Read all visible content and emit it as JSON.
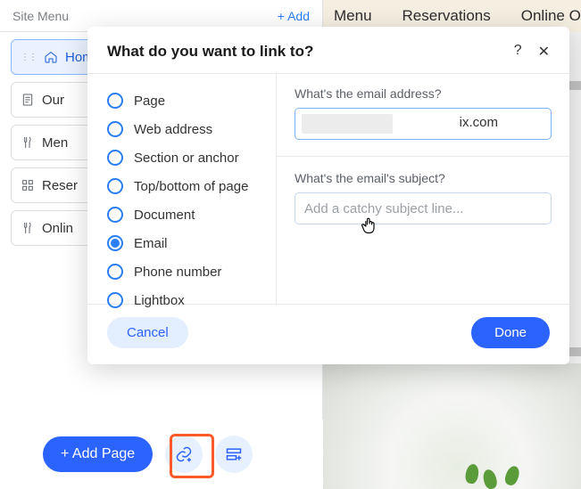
{
  "leftPanel": {
    "title": "Site Menu",
    "addLabel": "+  Add",
    "items": [
      {
        "label": "Hom"
      },
      {
        "label": "Our"
      },
      {
        "label": "Men"
      },
      {
        "label": "Reser"
      },
      {
        "label": "Onlin"
      }
    ]
  },
  "bottomBar": {
    "addPage": "+ Add Page"
  },
  "navPreview": {
    "items": [
      "Menu",
      "Reservations",
      "Online O"
    ]
  },
  "modal": {
    "title": "What do you want to link to?",
    "linkTypes": [
      "Page",
      "Web address",
      "Section or anchor",
      "Top/bottom of page",
      "Document",
      "Email",
      "Phone number",
      "Lightbox"
    ],
    "selectedIndex": 5,
    "emailLabel": "What's the email address?",
    "emailValueSuffix": "ix.com",
    "subjectLabel": "What's the email's subject?",
    "subjectPlaceholder": "Add a catchy subject line...",
    "cancel": "Cancel",
    "done": "Done"
  }
}
